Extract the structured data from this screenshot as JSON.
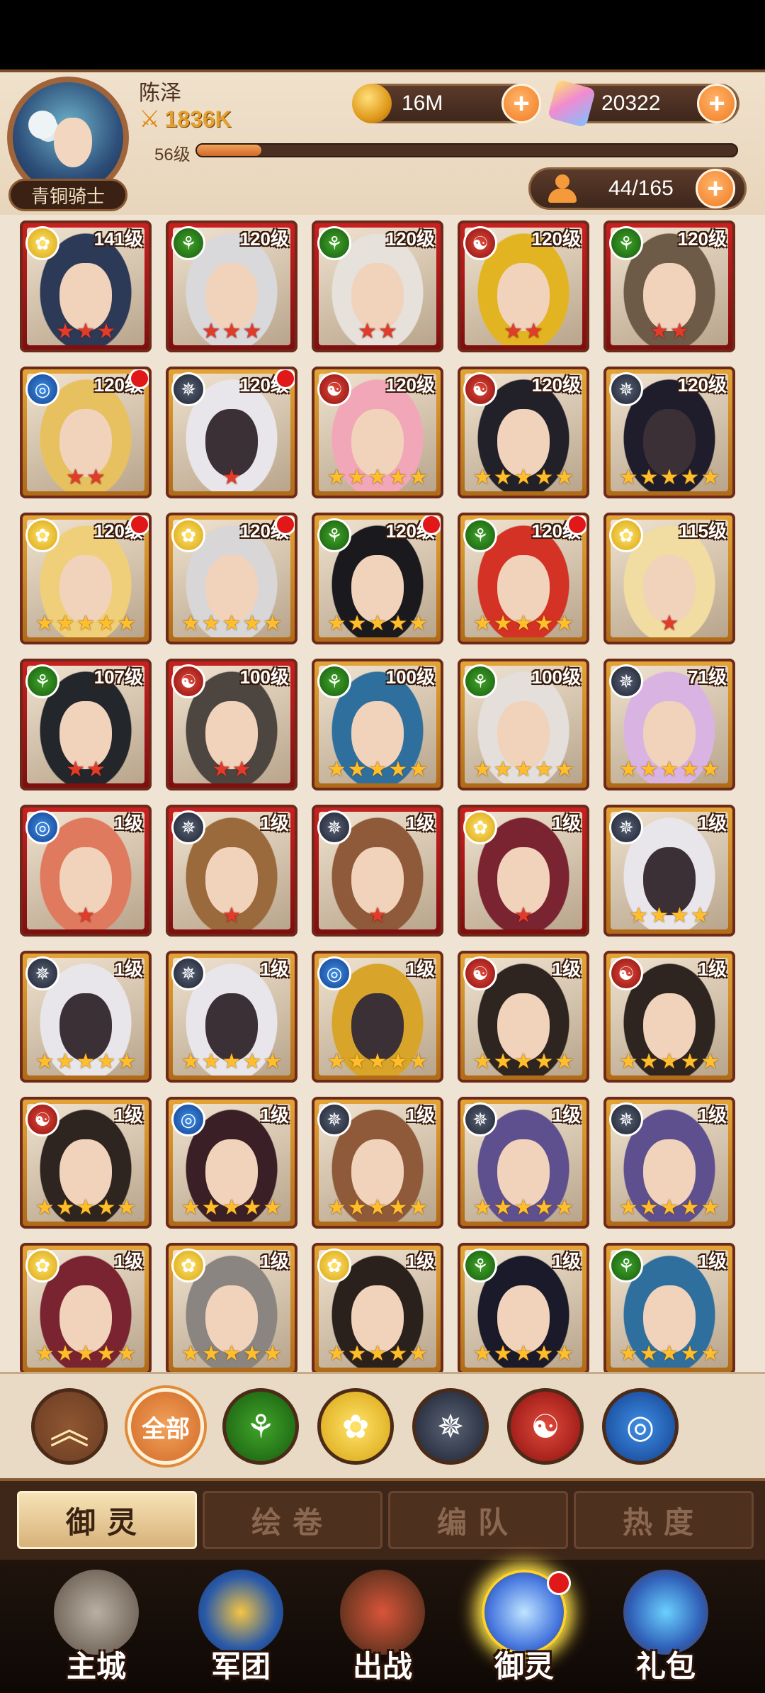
{
  "player": {
    "name": "陈泽",
    "power": "1836K",
    "level": "56级",
    "exp_fraction": 0.12,
    "rank": "青铜骑士"
  },
  "resources": {
    "coins": "16M",
    "gems": "20322",
    "heroes": "44/165"
  },
  "heroes": [
    {
      "level": "141级",
      "faction": "holy",
      "frame": "red",
      "stars": 3,
      "star_color": "red",
      "dot": false,
      "hair": "#2c3a58",
      "dark": false
    },
    {
      "level": "120级",
      "faction": "nature",
      "frame": "red",
      "stars": 3,
      "star_color": "red",
      "dot": false,
      "hair": "#d9d9dc",
      "dark": false
    },
    {
      "level": "120级",
      "faction": "nature",
      "frame": "red",
      "stars": 2,
      "star_color": "red",
      "dot": false,
      "hair": "#e6e1da",
      "dark": false
    },
    {
      "level": "120级",
      "faction": "fire",
      "frame": "red",
      "stars": 2,
      "star_color": "red",
      "dot": false,
      "hair": "#e3b422",
      "dark": false
    },
    {
      "level": "120级",
      "faction": "nature",
      "frame": "red",
      "stars": 2,
      "star_color": "red",
      "dot": false,
      "hair": "#6d5a47",
      "dark": false
    },
    {
      "level": "120级",
      "faction": "water",
      "frame": "gold",
      "stars": 2,
      "star_color": "red",
      "dot": true,
      "hair": "#e7c160",
      "dark": false
    },
    {
      "level": "120级",
      "faction": "dark",
      "frame": "gold",
      "stars": 1,
      "star_color": "red",
      "dot": true,
      "hair": "#e8e6ea",
      "dark": true
    },
    {
      "level": "120级",
      "faction": "fire",
      "frame": "gold",
      "stars": 5,
      "star_color": "gold",
      "dot": false,
      "hair": "#f1a7b8",
      "dark": false
    },
    {
      "level": "120级",
      "faction": "fire",
      "frame": "gold",
      "stars": 5,
      "star_color": "gold",
      "dot": false,
      "hair": "#222028",
      "dark": false
    },
    {
      "level": "120级",
      "faction": "dark",
      "frame": "gold",
      "stars": 5,
      "star_color": "gold",
      "dot": false,
      "hair": "#1f1c2c",
      "dark": true
    },
    {
      "level": "120级",
      "faction": "holy",
      "frame": "gold",
      "stars": 5,
      "star_color": "gold",
      "dot": true,
      "hair": "#f0cf7a",
      "dark": false
    },
    {
      "level": "120级",
      "faction": "holy",
      "frame": "gold",
      "stars": 5,
      "star_color": "gold",
      "dot": true,
      "hair": "#d8d6d6",
      "dark": false
    },
    {
      "level": "120级",
      "faction": "nature",
      "frame": "gold",
      "stars": 5,
      "star_color": "gold",
      "dot": true,
      "hair": "#1a1a1e",
      "dark": false
    },
    {
      "level": "120级",
      "faction": "nature",
      "frame": "gold",
      "stars": 5,
      "star_color": "gold",
      "dot": true,
      "hair": "#d33224",
      "dark": false
    },
    {
      "level": "115级",
      "faction": "holy",
      "frame": "gold",
      "stars": 1,
      "star_color": "red",
      "dot": false,
      "hair": "#f1dca2",
      "dark": false
    },
    {
      "level": "107级",
      "faction": "nature",
      "frame": "red",
      "stars": 2,
      "star_color": "red",
      "dot": false,
      "hair": "#23262a",
      "dark": false
    },
    {
      "level": "100级",
      "faction": "fire",
      "frame": "red",
      "stars": 2,
      "star_color": "red",
      "dot": false,
      "hair": "#4c4540",
      "dark": false
    },
    {
      "level": "100级",
      "faction": "nature",
      "frame": "gold",
      "stars": 5,
      "star_color": "gold",
      "dot": false,
      "hair": "#2f6f9e",
      "dark": false
    },
    {
      "level": "100级",
      "faction": "nature",
      "frame": "gold",
      "stars": 5,
      "star_color": "gold",
      "dot": false,
      "hair": "#e4dfdb",
      "dark": false
    },
    {
      "level": "71级",
      "faction": "dark",
      "frame": "gold",
      "stars": 5,
      "star_color": "gold",
      "dot": false,
      "hair": "#d9b3e2",
      "dark": false
    },
    {
      "level": "1级",
      "faction": "water",
      "frame": "red",
      "stars": 1,
      "star_color": "red",
      "dot": false,
      "hair": "#e07a5e",
      "dark": false
    },
    {
      "level": "1级",
      "faction": "dark",
      "frame": "red",
      "stars": 1,
      "star_color": "red",
      "dot": false,
      "hair": "#9a6a3c",
      "dark": false
    },
    {
      "level": "1级",
      "faction": "dark",
      "frame": "red",
      "stars": 1,
      "star_color": "red",
      "dot": false,
      "hair": "#8e5a3a",
      "dark": false
    },
    {
      "level": "1级",
      "faction": "holy",
      "frame": "red",
      "stars": 1,
      "star_color": "red",
      "dot": false,
      "hair": "#7a2431",
      "dark": false
    },
    {
      "level": "1级",
      "faction": "dark",
      "frame": "gold",
      "stars": 4,
      "star_color": "gold",
      "dot": false,
      "hair": "#e8e6ea",
      "dark": true
    },
    {
      "level": "1级",
      "faction": "dark",
      "frame": "gold",
      "stars": 5,
      "star_color": "gold",
      "dot": false,
      "hair": "#e8e6ea",
      "dark": true
    },
    {
      "level": "1级",
      "faction": "dark",
      "frame": "gold",
      "stars": 5,
      "star_color": "gold",
      "dot": false,
      "hair": "#e8e6ea",
      "dark": true
    },
    {
      "level": "1级",
      "faction": "water",
      "frame": "gold",
      "stars": 5,
      "star_color": "gold",
      "dot": false,
      "hair": "#d8a52a",
      "dark": true
    },
    {
      "level": "1级",
      "faction": "fire",
      "frame": "gold",
      "stars": 5,
      "star_color": "gold",
      "dot": false,
      "hair": "#2e2520",
      "dark": false
    },
    {
      "level": "1级",
      "faction": "fire",
      "frame": "gold",
      "stars": 5,
      "star_color": "gold",
      "dot": false,
      "hair": "#2e2520",
      "dark": false
    },
    {
      "level": "1级",
      "faction": "fire",
      "frame": "gold",
      "stars": 5,
      "star_color": "gold",
      "dot": false,
      "hair": "#2e2520",
      "dark": false
    },
    {
      "level": "1级",
      "faction": "water",
      "frame": "gold",
      "stars": 5,
      "star_color": "gold",
      "dot": false,
      "hair": "#3a1f26",
      "dark": false
    },
    {
      "level": "1级",
      "faction": "dark",
      "frame": "gold",
      "stars": 5,
      "star_color": "gold",
      "dot": false,
      "hair": "#8e5a3a",
      "dark": false
    },
    {
      "level": "1级",
      "faction": "dark",
      "frame": "gold",
      "stars": 5,
      "star_color": "gold",
      "dot": false,
      "hair": "#5e4f8e",
      "dark": false
    },
    {
      "level": "1级",
      "faction": "dark",
      "frame": "gold",
      "stars": 5,
      "star_color": "gold",
      "dot": false,
      "hair": "#5e4f8e",
      "dark": false
    },
    {
      "level": "1级",
      "faction": "holy",
      "frame": "gold",
      "stars": 5,
      "star_color": "gold",
      "dot": false,
      "hair": "#7a2431",
      "dark": false
    },
    {
      "level": "1级",
      "faction": "holy",
      "frame": "gold",
      "stars": 5,
      "star_color": "gold",
      "dot": false,
      "hair": "#8a8580",
      "dark": false
    },
    {
      "level": "1级",
      "faction": "holy",
      "frame": "gold",
      "stars": 5,
      "star_color": "gold",
      "dot": false,
      "hair": "#2a211d",
      "dark": false
    },
    {
      "level": "1级",
      "faction": "nature",
      "frame": "gold",
      "stars": 5,
      "star_color": "gold",
      "dot": false,
      "hair": "#1b1a2a",
      "dark": false
    },
    {
      "level": "1级",
      "faction": "nature",
      "frame": "gold",
      "stars": 5,
      "star_color": "gold",
      "dot": false,
      "hair": "#2f6f9e",
      "dark": false
    }
  ],
  "filters": {
    "collapse_icon": "chevron-double-up-icon",
    "all_label": "全部",
    "factions": [
      "nature",
      "holy",
      "dark",
      "fire",
      "water"
    ]
  },
  "tabs": [
    "御灵",
    "绘卷",
    "编队",
    "热度"
  ],
  "nav": [
    {
      "label": "主城",
      "icon": "castle-icon",
      "active": false,
      "badge": false
    },
    {
      "label": "军团",
      "icon": "shield-fist-icon",
      "active": false,
      "badge": false
    },
    {
      "label": "出战",
      "icon": "gate-swords-icon",
      "active": false,
      "badge": false
    },
    {
      "label": "御灵",
      "icon": "crystal-icon",
      "active": true,
      "badge": true
    },
    {
      "label": "礼包",
      "icon": "shop-icon",
      "active": false,
      "badge": false
    }
  ],
  "colors": {
    "accent": "#f07a23",
    "header_bg": "#efe1cc",
    "nav_bg": "#3e2618"
  }
}
